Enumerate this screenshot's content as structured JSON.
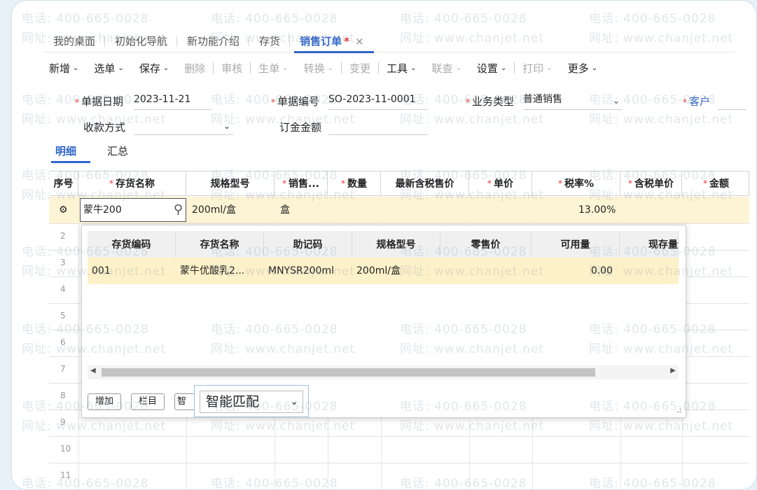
{
  "watermark": {
    "phone": "电话: 400-665-0028",
    "site": "网址: www.chanjet.net"
  },
  "tabs": [
    {
      "label": "我的桌面"
    },
    {
      "label": "初始化导航"
    },
    {
      "label": "新功能介绍"
    },
    {
      "label": "存货"
    },
    {
      "label": "销售订单",
      "star": "*",
      "close": "×"
    }
  ],
  "toolbar": [
    {
      "label": "新增",
      "caret": "⌄"
    },
    {
      "label": "选单",
      "caret": "⌄"
    },
    {
      "label": "保存",
      "caret": "⌄"
    },
    {
      "label": "删除"
    },
    {
      "label": "审核"
    },
    {
      "label": "生单",
      "caret": "⌄"
    },
    {
      "label": "转换",
      "caret": "⌄"
    },
    {
      "label": "变更"
    },
    {
      "label": "工具",
      "caret": "⌄"
    },
    {
      "label": "联查",
      "caret": "⌄"
    },
    {
      "label": "设置",
      "caret": "⌄"
    },
    {
      "label": "打印",
      "caret": "⌄"
    },
    {
      "label": "更多",
      "caret": "⌄"
    }
  ],
  "form": {
    "date_label": "单据日期",
    "date_value": "2023-11-21",
    "no_label": "单据编号",
    "no_value": "SO-2023-11-0001",
    "biz_label": "业务类型",
    "biz_value": "普通销售",
    "customer_label": "客户",
    "pay_label": "收款方式",
    "deposit_label": "订金金额"
  },
  "subtabs": [
    "明细",
    "汇总"
  ],
  "grid": {
    "headers": [
      "序号",
      "存货名称",
      "规格型号",
      "销售...",
      "数量",
      "最新含税售价",
      "单价",
      "税率%",
      "含税单价",
      "金额"
    ],
    "row1": {
      "name": "蒙牛200",
      "spec": "200ml/盒",
      "unit": "盒",
      "tax": "13.00%"
    },
    "row_numbers": [
      "2",
      "3",
      "4",
      "5",
      "6",
      "7",
      "8",
      "9",
      "10",
      "11"
    ]
  },
  "popup": {
    "headers": [
      "存货编码",
      "存货名称",
      "助记码",
      "规格型号",
      "零售价",
      "可用量",
      "现存量"
    ],
    "row": [
      "001",
      "蒙牛优酸乳2...",
      "MNYSR200ml",
      "200ml/盒",
      "",
      "0.00",
      ""
    ],
    "buttons": [
      "增加",
      "栏目",
      "智能"
    ],
    "match_value": "智能匹配",
    "resize": ".:"
  },
  "icons": {
    "search": "search-icon",
    "row_settings": "gear-icon",
    "chevron": "chevron-down-icon"
  }
}
